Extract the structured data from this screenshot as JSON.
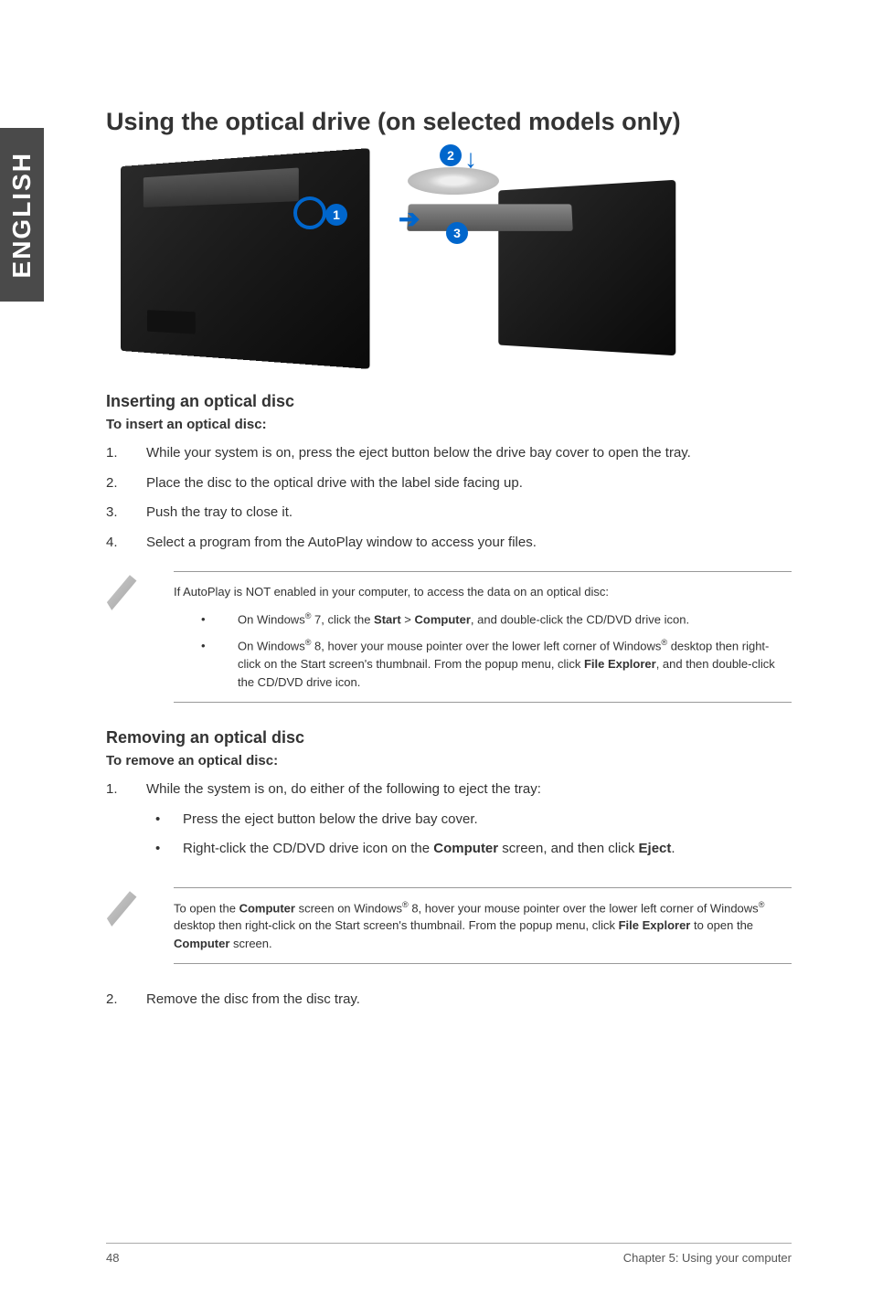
{
  "side_tab": "ENGLISH",
  "title": "Using the optical drive (on selected models only)",
  "callouts": {
    "c1": "1",
    "c2": "2",
    "c3": "3"
  },
  "insert": {
    "heading": "Inserting an optical disc",
    "lead": "To insert an optical disc:",
    "steps": [
      {
        "n": "1.",
        "text": "While your system is on, press the eject button below the drive bay cover to open the tray."
      },
      {
        "n": "2.",
        "text": "Place the disc to the optical drive with the label side facing up."
      },
      {
        "n": "3.",
        "text": "Push the tray to close it."
      },
      {
        "n": "4.",
        "text": "Select a program from the AutoPlay window to access your files."
      }
    ]
  },
  "note1": {
    "intro": "If AutoPlay is NOT enabled in your computer, to access the data on an optical disc:",
    "b1a": "On Windows",
    "b1b": " 7, click the ",
    "b1_start": "Start",
    "b1_gt": " > ",
    "b1_comp": "Computer",
    "b1c": ", and double-click the CD/DVD drive icon.",
    "b2a": "On Windows",
    "b2b": " 8, hover your mouse pointer over the lower left corner of Windows",
    "b2c": " desktop then right-click on the Start screen's thumbnail. From the popup menu, click ",
    "b2_fe": "File Explorer",
    "b2d": ", and then double-click the CD/DVD drive icon."
  },
  "remove": {
    "heading": "Removing an optical disc",
    "lead": "To remove an optical disc:",
    "step1": {
      "n": "1.",
      "text": "While the system is on, do either of the following to eject the tray:"
    },
    "sub1": "Press the eject button below the drive bay cover.",
    "sub2a": "Right-click the CD/DVD drive icon on the ",
    "sub2_comp": "Computer",
    "sub2b": " screen, and then click ",
    "sub2_eject": "Eject",
    "sub2c": ".",
    "step2": {
      "n": "2.",
      "text": "Remove the disc from the disc tray."
    }
  },
  "note2": {
    "a": "To open the ",
    "comp1": "Computer",
    "b": " screen on Windows",
    "c": " 8, hover your mouse pointer over the lower left corner of Windows",
    "d": " desktop then right-click on the Start screen's thumbnail. From the popup menu, click ",
    "fe": "File Explorer",
    "e": " to open the ",
    "comp2": "Computer",
    "f": " screen."
  },
  "reg": "®",
  "bullet": "•",
  "footer": {
    "page": "48",
    "chapter": "Chapter 5: Using your computer"
  }
}
